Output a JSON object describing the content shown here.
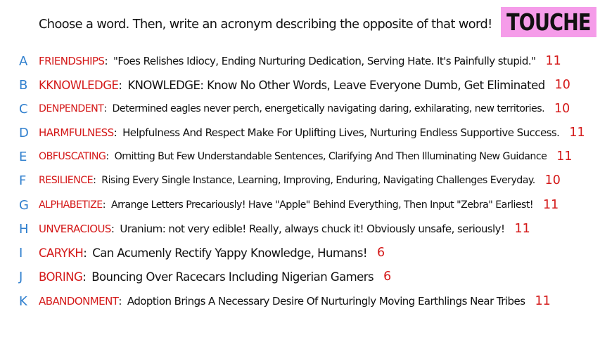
{
  "title": "Choose a word. Then, write an acronym describing the opposite of that word!",
  "logo": "TOUCHE",
  "entries": [
    {
      "letter": "A",
      "word": "FRIENDSHIPS",
      "acronym": "\"Foes Relishes Idiocy, Ending Nurturing Dedication, Serving Hate. It's Painfully stupid.\"",
      "count": "11"
    },
    {
      "letter": "B",
      "word": "KKNOWLEDGE",
      "acronym": "KNOWLEDGE: Know No Other Words, Leave Everyone Dumb, Get Eliminated",
      "count": "10"
    },
    {
      "letter": "C",
      "word": "DENPENDENT",
      "acronym": "Determined eagles never perch, energetically navigating daring, exhilarating, new territories.",
      "count": "10"
    },
    {
      "letter": "D",
      "word": "HARMFULNESS",
      "acronym": "Helpfulness And Respect Make For Uplifting Lives, Nurturing Endless Supportive Success.",
      "count": "11"
    },
    {
      "letter": "E",
      "word": "OBFUSCATING",
      "acronym": "Omitting But Few Understandable Sentences, Clarifying And Then Illuminating New Guidance",
      "count": "11"
    },
    {
      "letter": "F",
      "word": "RESILIENCE",
      "acronym": "Rising Every Single Instance, Learning, Improving, Enduring, Navigating Challenges Everyday.",
      "count": "10"
    },
    {
      "letter": "G",
      "word": "ALPHABETIZE",
      "acronym": "Arrange Letters Precariously! Have \"Apple\" Behind Everything, Then Input \"Zebra\" Earliest!",
      "count": "11"
    },
    {
      "letter": "H",
      "word": "UNVERACIOUS",
      "acronym": "Uranium: not very edible! Really, always chuck it! Obviously unsafe, seriously!",
      "count": "11"
    },
    {
      "letter": "I",
      "word": "CARYKH",
      "acronym": "Can Acumenly Rectify Yappy Knowledge, Humans!",
      "count": "6"
    },
    {
      "letter": "J",
      "word": "BORING",
      "acronym": "Bouncing Over Racecars Including Nigerian Gamers",
      "count": "6"
    },
    {
      "letter": "K",
      "word": "ABANDONMENT",
      "acronym": "Adoption Brings A Necessary Desire Of Nurturingly Moving Earthlings Near Tribes",
      "count": "11"
    }
  ]
}
